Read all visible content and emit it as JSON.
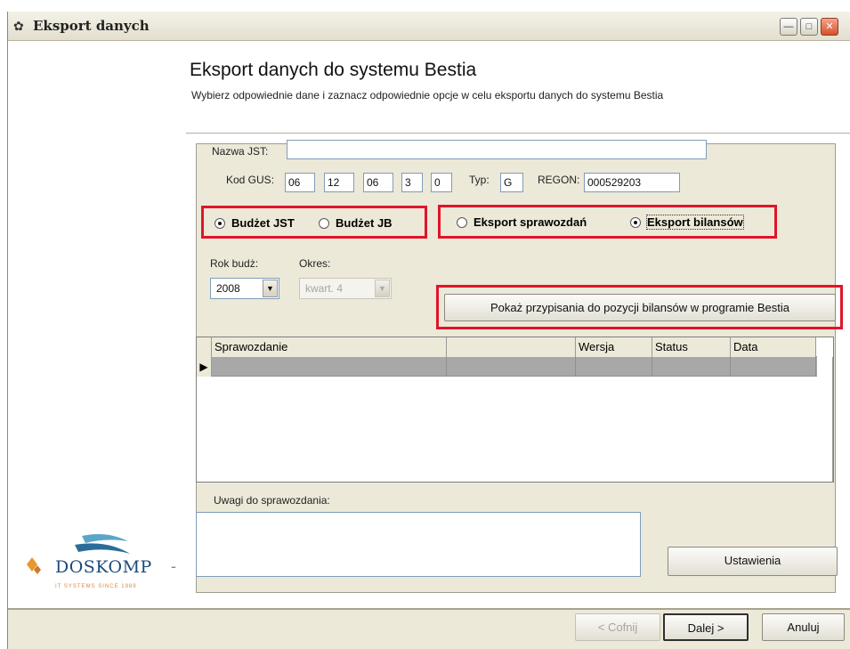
{
  "window": {
    "title": "Eksport danych"
  },
  "header": {
    "title": "Eksport danych do systemu Bestia",
    "subtitle": "Wybierz odpowiednie dane i zaznacz odpowiednie opcje w celu eksportu danych do systemu Bestia"
  },
  "form": {
    "nazwa_jst_label": "Nazwa JST:",
    "nazwa_jst_value": "",
    "kod_gus_label": "Kod GUS:",
    "kod_gus_values": [
      "06",
      "12",
      "06",
      "3",
      "0"
    ],
    "typ_label": "Typ:",
    "typ_value": "G",
    "regon_label": "REGON:",
    "regon_value": "000529203"
  },
  "budget": {
    "options": [
      {
        "label": "Budżet JST",
        "selected": true
      },
      {
        "label": "Budżet JB",
        "selected": false
      }
    ]
  },
  "export": {
    "options": [
      {
        "label": "Eksport sprawozdań",
        "selected": false
      },
      {
        "label": "Eksport bilansów",
        "selected": true
      }
    ]
  },
  "period": {
    "rok_label": "Rok budż:",
    "rok_value": "2008",
    "okres_label": "Okres:",
    "okres_value": "kwart. 4"
  },
  "mapping_button": "Pokaż przypisania do pozycji bilansów w programie Bestia",
  "grid": {
    "columns": [
      "Sprawozdanie",
      "",
      "Wersja",
      "Status",
      "Data"
    ]
  },
  "notes": {
    "label": "Uwagi do sprawozdania:",
    "value": ""
  },
  "settings_button": "Ustawienia",
  "logo": {
    "name": "DOSKOMP",
    "tagline": "IT SYSTEMS SINCE 1989"
  },
  "footer": {
    "back": "< Cofnij",
    "next": "Dalej >",
    "cancel": "Anuluj"
  },
  "colors": {
    "highlight": "#e0152a",
    "panel": "#ece9d8",
    "selected_row": "#a8a8a8"
  }
}
